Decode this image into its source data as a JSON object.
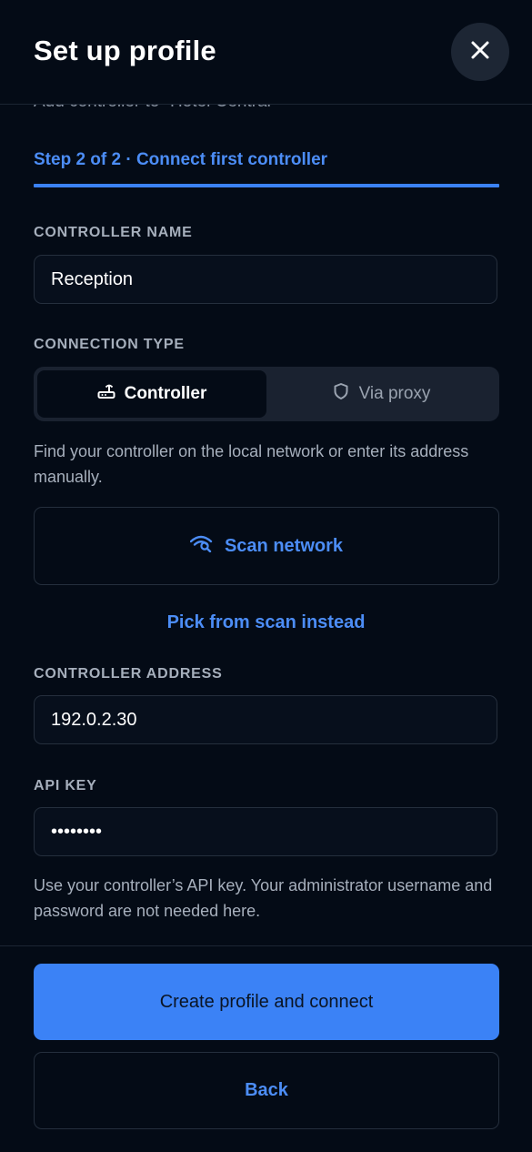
{
  "header": {
    "title": "Set up profile",
    "close_icon": "close-icon"
  },
  "scrolled_subtitle": "Add controller to “Hotel Central”",
  "step": {
    "label": "Step 2 of 2 · Connect first controller",
    "progress": 1.0
  },
  "controller_name": {
    "label": "CONTROLLER NAME",
    "value": "Reception"
  },
  "connection_type": {
    "label": "CONNECTION TYPE",
    "options": [
      {
        "label": "Controller",
        "icon": "router-icon",
        "selected": true
      },
      {
        "label": "Via proxy",
        "icon": "shield-icon",
        "selected": false
      }
    ]
  },
  "discovery_help": "Find your controller on the local network or enter its address manually.",
  "scan_button": {
    "label": "Scan network",
    "icon": "wifi-search-icon"
  },
  "pick_link": "Pick from scan instead",
  "controller_address": {
    "label": "CONTROLLER ADDRESS",
    "value": "192.0.2.30"
  },
  "api_key": {
    "label": "API KEY",
    "value": "••••••••"
  },
  "api_key_help": "Use your controller’s API key. Your administrator username and password are not needed here.",
  "buttons": {
    "primary": "Create profile and connect",
    "secondary": "Back"
  },
  "colors": {
    "background": "#040b16",
    "accent": "#3b82f6",
    "link": "#4c8df6",
    "muted_text": "#a6afbc"
  }
}
